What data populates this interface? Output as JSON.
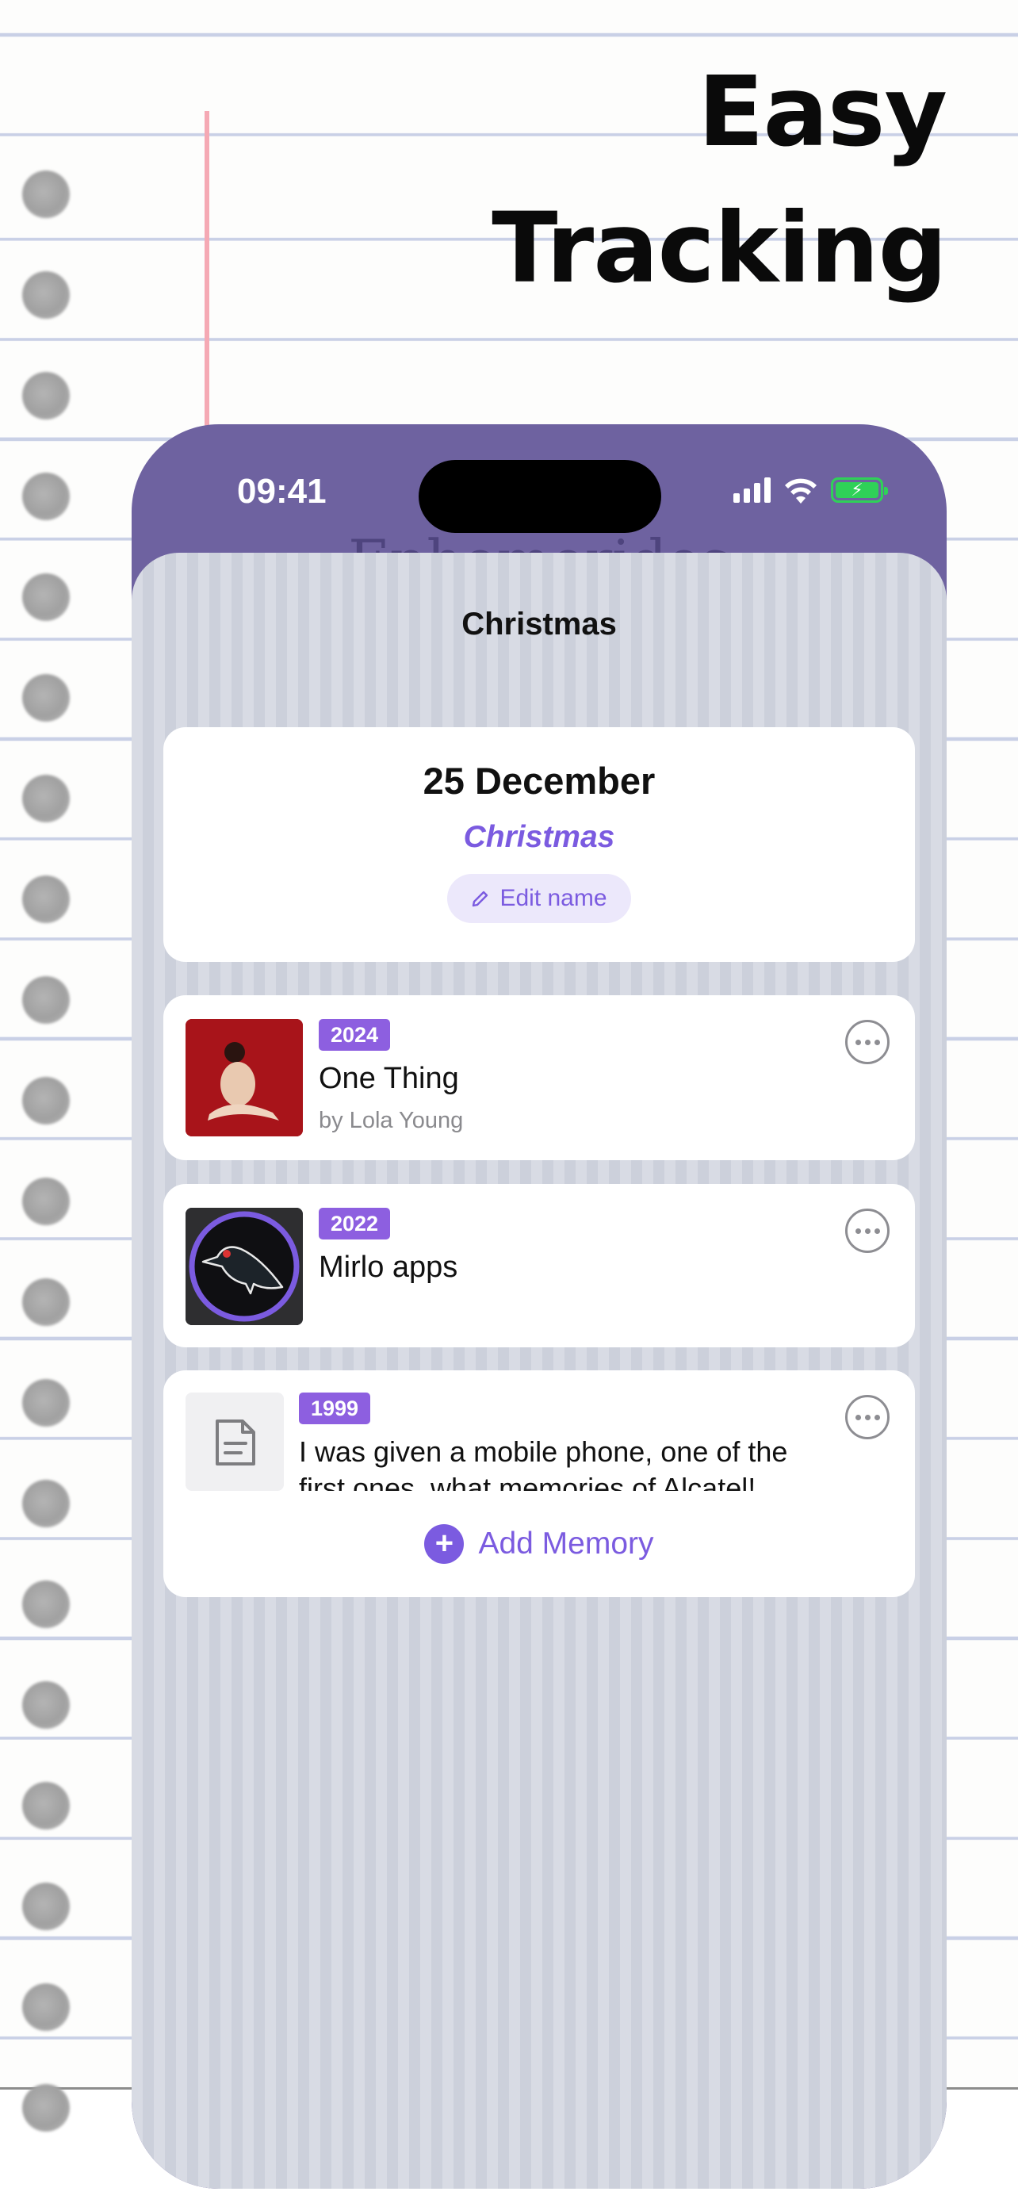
{
  "marketing": {
    "headline_line1": "Easy",
    "headline_line2": "Tracking"
  },
  "status_bar": {
    "time": "09:41",
    "icons": [
      "cellular-signal-icon",
      "wifi-icon",
      "battery-charging-icon"
    ]
  },
  "screen": {
    "title": "Christmas",
    "background_title": "Ephemerides"
  },
  "date_card": {
    "date": "25 December",
    "event_name": "Christmas",
    "edit_label": "Edit name"
  },
  "memories": [
    {
      "year": "2024",
      "title": "One Thing",
      "subtitle": "by Lola Young",
      "thumb": "album-cover"
    },
    {
      "year": "2022",
      "title": "Mirlo apps",
      "thumb": "blackbird-logo"
    },
    {
      "year": "1999",
      "text": "I was given a mobile phone, one of the first ones, what memories of Alcatel!",
      "thumb": "document-icon"
    }
  ],
  "add_memory": {
    "label": "Add Memory"
  },
  "colors": {
    "accent": "#7b5be0",
    "badge": "#8d5fe0",
    "phone_header": "#6e62a0",
    "sheet": "#d3d7e1"
  }
}
